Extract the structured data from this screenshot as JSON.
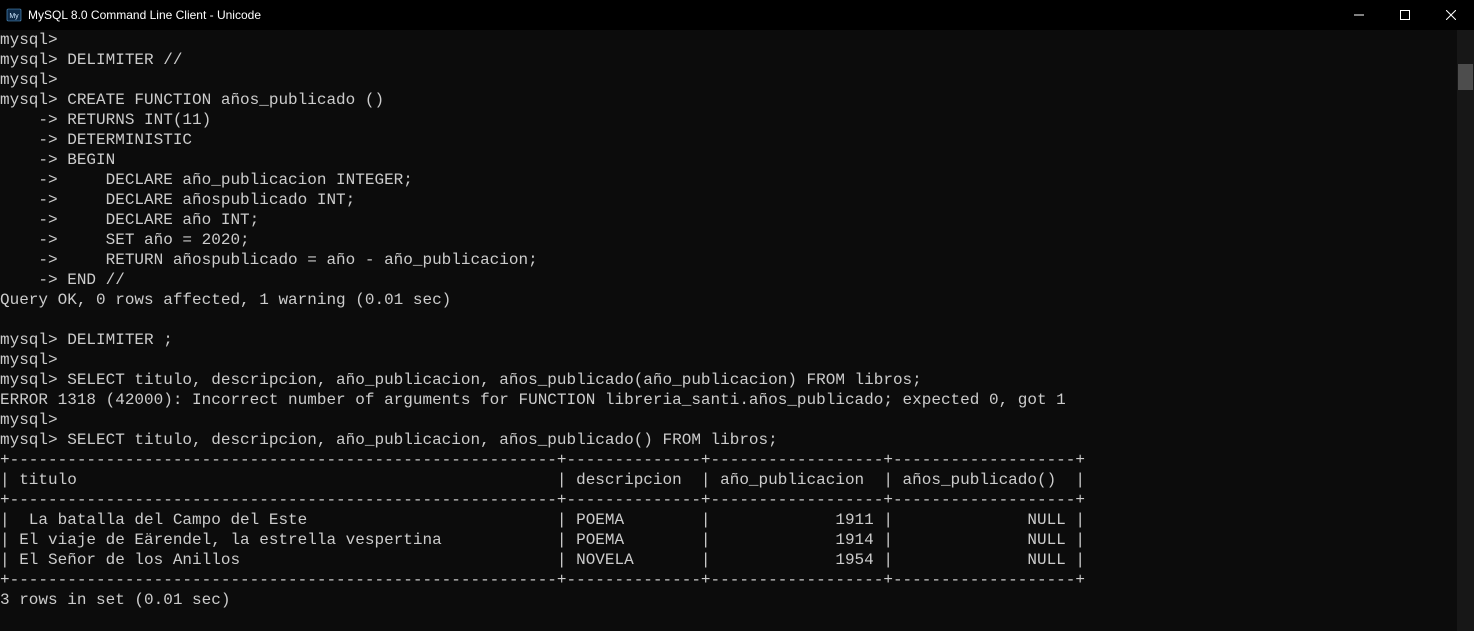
{
  "window": {
    "title": "MySQL 8.0 Command Line Client - Unicode"
  },
  "terminal": {
    "lines": [
      "mysql>",
      "mysql> DELIMITER //",
      "mysql>",
      "mysql> CREATE FUNCTION años_publicado ()",
      "    -> RETURNS INT(11)",
      "    -> DETERMINISTIC",
      "    -> BEGIN",
      "    ->     DECLARE año_publicacion INTEGER;",
      "    ->     DECLARE añospublicado INT;",
      "    ->     DECLARE año INT;",
      "    ->     SET año = 2020;",
      "    ->     RETURN añospublicado = año - año_publicacion;",
      "    -> END //",
      "Query OK, 0 rows affected, 1 warning (0.01 sec)",
      "",
      "mysql> DELIMITER ;",
      "mysql>",
      "mysql> SELECT titulo, descripcion, año_publicacion, años_publicado(año_publicacion) FROM libros;",
      "ERROR 1318 (42000): Incorrect number of arguments for FUNCTION libreria_santi.años_publicado; expected 0, got 1",
      "mysql>",
      "mysql> SELECT titulo, descripcion, año_publicacion, años_publicado() FROM libros;",
      "+---------------------------------------------------------+--------------+------------------+-------------------+",
      "| titulo                                                  | descripcion  | año_publicacion  | años_publicado()  |",
      "+---------------------------------------------------------+--------------+------------------+-------------------+",
      "|  La batalla del Campo del Este                          | POEMA        |             1911 |              NULL |",
      "| El viaje de Eärendel, la estrella vespertina            | POEMA        |             1914 |              NULL |",
      "| El Señor de los Anillos                                 | NOVELA       |             1954 |              NULL |",
      "+---------------------------------------------------------+--------------+------------------+-------------------+",
      "3 rows in set (0.01 sec)"
    ]
  },
  "result_table": {
    "columns": [
      "titulo",
      "descripcion",
      "año_publicacion",
      "años_publicado()"
    ],
    "rows": [
      {
        "titulo": " La batalla del Campo del Este",
        "descripcion": "POEMA",
        "año_publicacion": 1911,
        "años_publicado()": "NULL"
      },
      {
        "titulo": "El viaje de Eärendel, la estrella vespertina",
        "descripcion": "POEMA",
        "año_publicacion": 1914,
        "años_publicado()": "NULL"
      },
      {
        "titulo": "El Señor de los Anillos",
        "descripcion": "NOVELA",
        "año_publicacion": 1954,
        "años_publicado()": "NULL"
      }
    ],
    "summary": "3 rows in set (0.01 sec)"
  }
}
